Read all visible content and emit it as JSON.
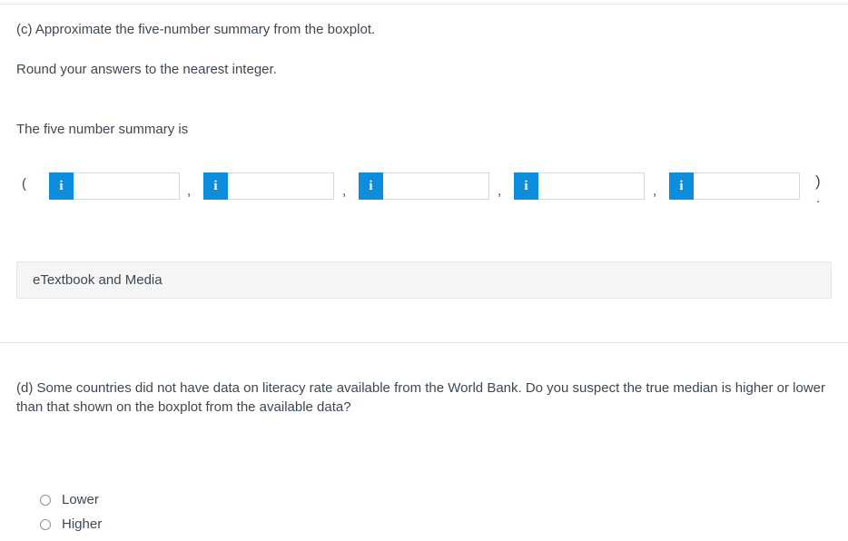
{
  "question_c": {
    "prompt": "(c) Approximate the five-number summary from the boxplot.",
    "rounding_note": "Round your answers to the nearest integer.",
    "summary_label": "The five number summary is",
    "paren_open": "(",
    "paren_close": ")",
    "separator": ",",
    "trailing_period": ".",
    "info_icon_label": "i",
    "fields": [
      {
        "name": "minimum",
        "value": "",
        "placeholder": ""
      },
      {
        "name": "first-quartile",
        "value": "",
        "placeholder": ""
      },
      {
        "name": "median",
        "value": "",
        "placeholder": ""
      },
      {
        "name": "third-quartile",
        "value": "",
        "placeholder": ""
      },
      {
        "name": "maximum",
        "value": "",
        "placeholder": ""
      }
    ]
  },
  "etextbook": {
    "label": "eTextbook and Media"
  },
  "question_d": {
    "prompt": "(d) Some countries did not have data on literacy rate available from the World Bank. Do you suspect the true median is higher or lower than that shown on the boxplot from the available data?",
    "options": [
      {
        "label": "Lower",
        "selected": false
      },
      {
        "label": "Higher",
        "selected": false
      }
    ]
  },
  "colors": {
    "accent_blue": "#0d8ddb",
    "text": "#3d4852",
    "rule": "#e3e5e8",
    "panel_bg": "#f5f5f5",
    "panel_border": "#e6e6e6",
    "input_border": "#d6d9dc",
    "radio_border": "#8d9399"
  }
}
